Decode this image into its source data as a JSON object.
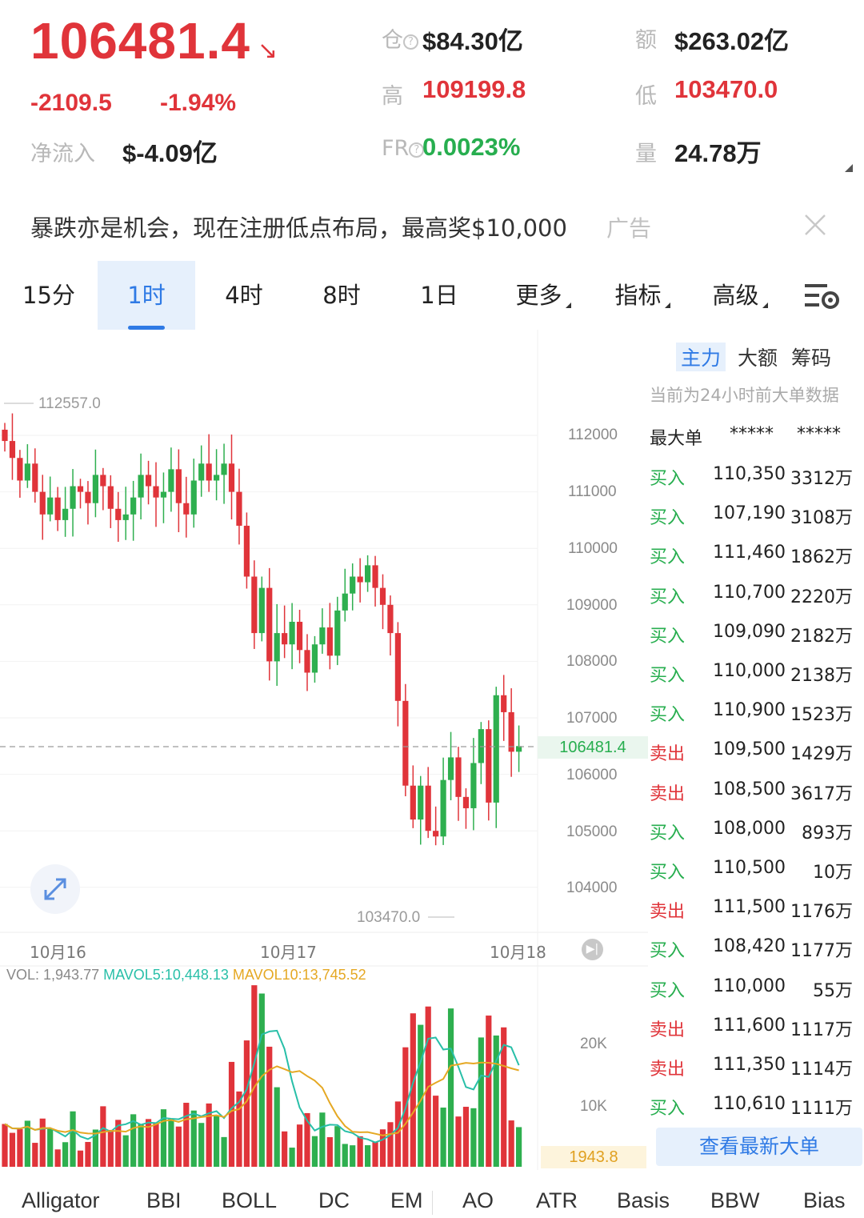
{
  "header": {
    "price": "106481.4",
    "change": "-2109.5",
    "change_pct": "-1.94%",
    "net_inflow_label": "净流入",
    "net_inflow": "$-4.09亿",
    "oi_label": "仓",
    "oi": "$84.30亿",
    "amount_label": "额",
    "amount": "$263.02亿",
    "high_label": "高",
    "high": "109199.8",
    "low_label": "低",
    "low": "103470.0",
    "fr_label": "FR",
    "fr": "0.0023%",
    "volume_label": "量",
    "volume": "24.78万"
  },
  "ad": {
    "text": "暴跌亦是机会，现在注册低点布局，最高奖$10,000",
    "tag": "广告"
  },
  "tabs": [
    {
      "label": "15分"
    },
    {
      "label": "1时",
      "active": true
    },
    {
      "label": "4时"
    },
    {
      "label": "8时"
    },
    {
      "label": "1日"
    },
    {
      "label": "更多"
    },
    {
      "label": "指标"
    },
    {
      "label": "高级"
    }
  ],
  "chart": {
    "y_ticks": [
      "112000",
      "111000",
      "110000",
      "109000",
      "108000",
      "107000",
      "106000",
      "105000",
      "104000"
    ],
    "current_price": "106481.4",
    "high_label": "112557.0",
    "low_label": "103470.0",
    "dates": [
      "10月16",
      "10月17",
      "10月18"
    ],
    "vol_info": {
      "vol": "VOL: 1,943.77",
      "mavol5": "MAVOL5:10,448.13",
      "mavol10": "MAVOL10:13,745.52"
    },
    "vol_ticks": [
      "20K",
      "10K"
    ],
    "vol_current": "1943.8",
    "colors": {
      "up": "#2eaf4f",
      "down": "#e0343a",
      "ma5": "#28bfa8",
      "ma10": "#e5a823"
    }
  },
  "side": {
    "tabs": [
      {
        "label": "主力",
        "active": true
      },
      {
        "label": "大额"
      },
      {
        "label": "筹码"
      }
    ],
    "note": "当前为24小时前大单数据",
    "header": {
      "type": "最大单",
      "price": "*****",
      "amount": "*****"
    },
    "rows": [
      {
        "type": "买入",
        "side": "buy",
        "price": "110,350",
        "amount": "3312万"
      },
      {
        "type": "买入",
        "side": "buy",
        "price": "107,190",
        "amount": "3108万"
      },
      {
        "type": "买入",
        "side": "buy",
        "price": "111,460",
        "amount": "1862万"
      },
      {
        "type": "买入",
        "side": "buy",
        "price": "110,700",
        "amount": "2220万"
      },
      {
        "type": "买入",
        "side": "buy",
        "price": "109,090",
        "amount": "2182万"
      },
      {
        "type": "买入",
        "side": "buy",
        "price": "110,000",
        "amount": "2138万"
      },
      {
        "type": "买入",
        "side": "buy",
        "price": "110,900",
        "amount": "1523万"
      },
      {
        "type": "卖出",
        "side": "sell",
        "price": "109,500",
        "amount": "1429万"
      },
      {
        "type": "卖出",
        "side": "sell",
        "price": "108,500",
        "amount": "3617万"
      },
      {
        "type": "买入",
        "side": "buy",
        "price": "108,000",
        "amount": "893万"
      },
      {
        "type": "买入",
        "side": "buy",
        "price": "110,500",
        "amount": "10万"
      },
      {
        "type": "卖出",
        "side": "sell",
        "price": "111,500",
        "amount": "1176万"
      },
      {
        "type": "买入",
        "side": "buy",
        "price": "108,420",
        "amount": "1177万"
      },
      {
        "type": "买入",
        "side": "buy",
        "price": "110,000",
        "amount": "55万"
      },
      {
        "type": "卖出",
        "side": "sell",
        "price": "111,600",
        "amount": "1117万"
      },
      {
        "type": "卖出",
        "side": "sell",
        "price": "111,350",
        "amount": "1114万"
      },
      {
        "type": "买入",
        "side": "buy",
        "price": "110,610",
        "amount": "1111万"
      }
    ],
    "button": "查看最新大单"
  },
  "indicators": [
    "Alligator",
    "BBI",
    "BOLL",
    "DC",
    "EM",
    "AO",
    "ATR",
    "Basis",
    "BBW",
    "Bias"
  ]
}
